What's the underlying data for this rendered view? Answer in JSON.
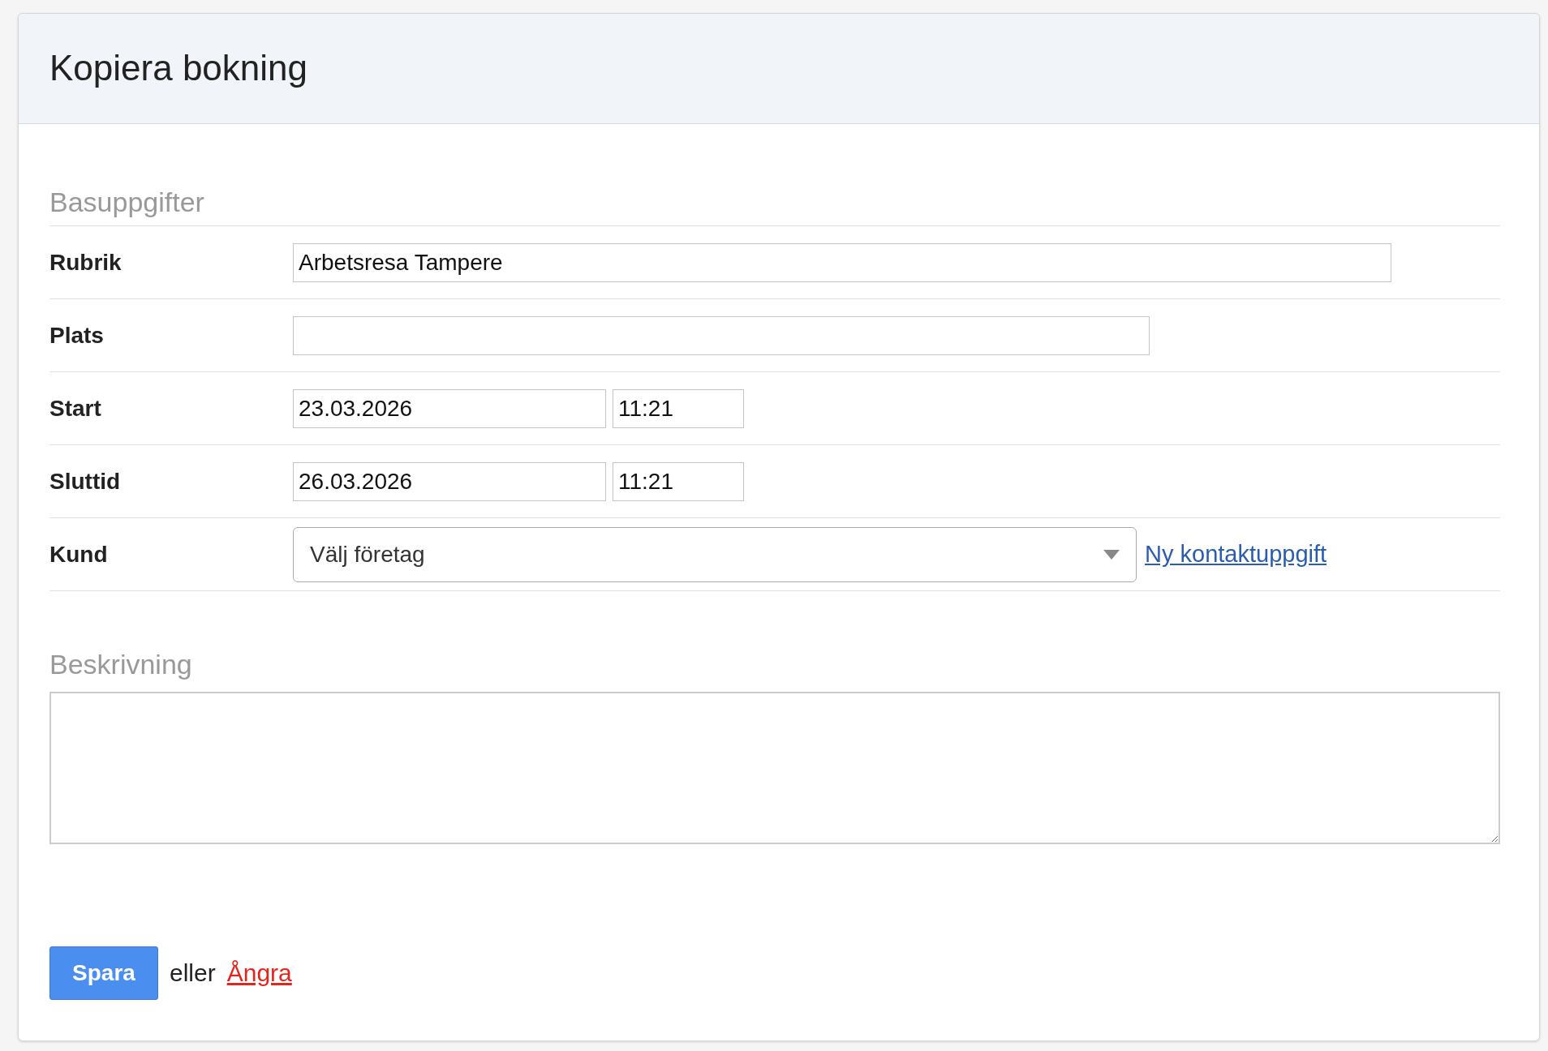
{
  "title": "Kopiera bokning",
  "sections": [
    {
      "heading": "Basuppgifter"
    }
  ],
  "fields": [
    {
      "kind": "text",
      "label": "Rubrik",
      "value": "Arbetsresa Tampere"
    },
    {
      "kind": "text",
      "label": "Plats"
    },
    {
      "kind": "datetime",
      "label": "Start",
      "date": "23.03.2026",
      "time": "11:21"
    },
    {
      "kind": "datetime",
      "label": "Sluttid",
      "date": "26.03.2026",
      "time": "11:21"
    },
    {
      "kind": "select",
      "label": "Kund",
      "value": "Välj företag",
      "link": "Ny kontaktuppgift"
    }
  ],
  "description": {
    "heading": "Beskrivning"
  },
  "actions": {
    "save": "Spara",
    "separator": "eller",
    "cancel": "Ångra"
  }
}
